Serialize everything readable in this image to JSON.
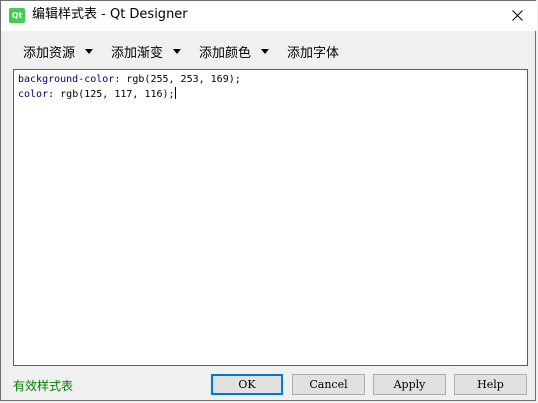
{
  "window": {
    "title": "编辑样式表 - Qt Designer",
    "app_icon_text": "Qt",
    "close_icon": "close-icon"
  },
  "toolbar": {
    "items": [
      {
        "label": "添加资源",
        "icon": "chevron-down-icon"
      },
      {
        "label": "添加渐变",
        "icon": "chevron-down-icon"
      },
      {
        "label": "添加颜色",
        "icon": "chevron-down-icon"
      },
      {
        "label": "添加字体"
      }
    ]
  },
  "editor": {
    "lines": [
      {
        "property": "background-color",
        "value": "rgb(255, 253, 169);"
      },
      {
        "property": "color",
        "value": "rgb(125, 117, 116);"
      }
    ],
    "separator": ": "
  },
  "status": {
    "text": "有效样式表",
    "color": "#008000"
  },
  "buttons": {
    "ok": "OK",
    "cancel": "Cancel",
    "apply": "Apply",
    "help": "Help"
  },
  "colors": {
    "focus_border": "#0078d7",
    "keyword": "#000080"
  }
}
